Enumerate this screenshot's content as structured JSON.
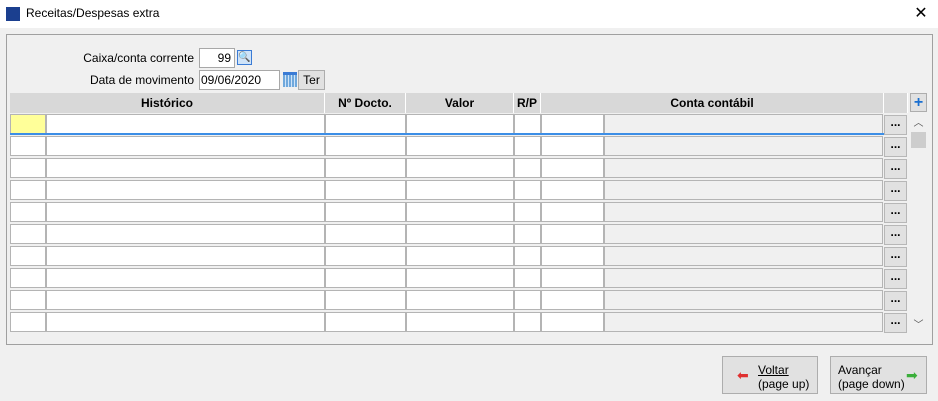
{
  "window": {
    "title": "Receitas/Despesas extra",
    "close": "✕"
  },
  "form": {
    "caixa_label": "Caixa/conta corrente",
    "caixa_value": "99",
    "data_label": "Data de movimento",
    "data_value": "09/06/2020",
    "day_button": "Ter"
  },
  "grid": {
    "headers": [
      "Histórico",
      "Nº Docto.",
      "Valor",
      "R/P",
      "Conta contábil"
    ],
    "row_count": 10,
    "ellipsis": "...",
    "add": "+"
  },
  "buttons": {
    "back_line1": "Voltar",
    "back_line2": "(page up)",
    "next_line1": "Avançar",
    "next_line2": "(page down)"
  }
}
